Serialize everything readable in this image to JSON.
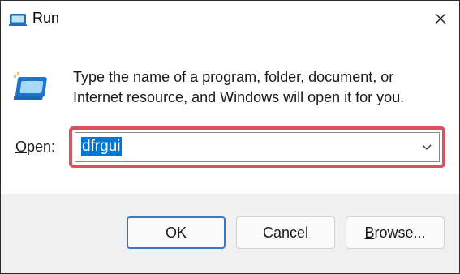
{
  "window": {
    "title": "Run",
    "close_icon": "close-icon",
    "app_icon": "run-icon"
  },
  "dialog": {
    "description_line1": "Type the name of a program, folder, document, or",
    "description_line2": "Internet resource, and Windows will open it for you.",
    "open_label_prefix": "O",
    "open_label_rest": "pen:",
    "open_value": "dfrgui",
    "highlight_color": "#d9535f",
    "selection_color": "#0078d7"
  },
  "buttons": {
    "ok_label": "OK",
    "cancel_label": "Cancel",
    "browse_label_prefix": "B",
    "browse_label_rest": "rowse..."
  }
}
